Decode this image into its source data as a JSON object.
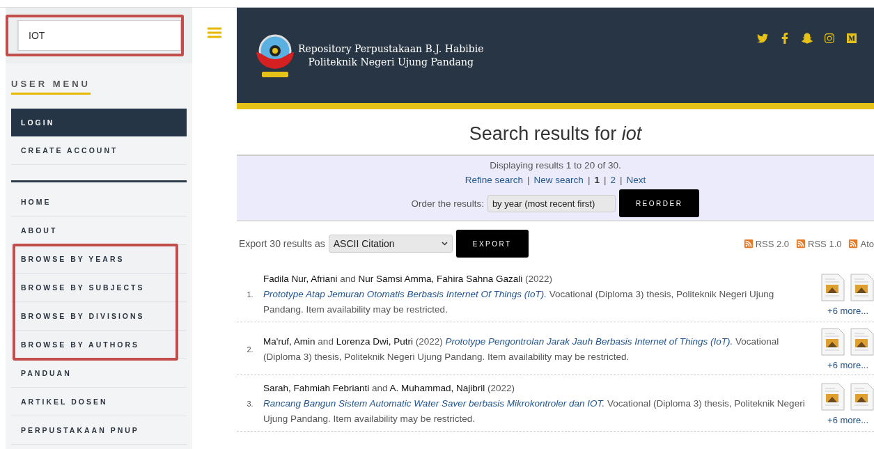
{
  "sidebar": {
    "search": {
      "value": "IOT",
      "highlighted": true
    },
    "user_menu": {
      "title": "USER MENU",
      "items": [
        {
          "label": "LOGIN",
          "selected": true
        },
        {
          "label": "CREATE ACCOUNT",
          "selected": false
        }
      ]
    },
    "nav_items": [
      {
        "label": "HOME",
        "highlighted": false
      },
      {
        "label": "ABOUT",
        "highlighted": false
      },
      {
        "label": "BROWSE BY YEARS",
        "highlighted": true
      },
      {
        "label": "BROWSE BY SUBJECTS",
        "highlighted": true
      },
      {
        "label": "BROWSE BY DIVISIONS",
        "highlighted": true
      },
      {
        "label": "BROWSE BY AUTHORS",
        "highlighted": true
      },
      {
        "label": "PANDUAN",
        "highlighted": false
      },
      {
        "label": "ARTIKEL DOSEN",
        "highlighted": false
      },
      {
        "label": "PERPUSTAKAAN PNUP",
        "highlighted": false
      }
    ]
  },
  "header": {
    "title_lines": [
      "Repository Perpustakaan B.J. Habibie",
      "Politeknik Negeri Ujung Pandang"
    ]
  },
  "search_title": "Search results for *iot*",
  "summary": {
    "text": "Displaying results 1 to 20 of 30.",
    "separator": "|",
    "links": [
      {
        "label": "Refine search",
        "kind": "link"
      },
      {
        "label": "New search",
        "kind": "link"
      },
      {
        "label": "1",
        "kind": "current"
      },
      {
        "label": "2",
        "kind": "link"
      },
      {
        "label": "Next",
        "kind": "link"
      }
    ],
    "order_label": "Order the results:",
    "order_value": "by year (most recent first)",
    "reorder_button": "REORDER"
  },
  "export": {
    "label": "Export 30 results as",
    "format": "ASCII Citation",
    "button": "EXPORT",
    "feeds": [
      "RSS 2.0",
      "RSS 1.0",
      "Ato"
    ]
  },
  "results": [
    {
      "number": "1.",
      "authors": "**Fadila Nur, Afriani** and **Nur Samsi Amma, Fahira Sahna Gazali**",
      "year": "(2022)",
      "title": "Prototype Atap Jemuran Otomatis Berbasis Internet Of Things (IoT).",
      "rest": "Vocational (Diploma 3) thesis, Politeknik Negeri Ujung Pandang. Item availability may be restricted.",
      "more": "+6 more..."
    },
    {
      "number": "2.",
      "authors": "**Ma'ruf, Amin** and **Lorenza Dwi, Putri**",
      "year": "(2022)",
      "title": "Prototype Pengontrolan Jarak Jauh Berbasis Internet of Things (IoT).",
      "rest": "Vocational (Diploma 3) thesis, Politeknik Negeri Ujung Pandang. Item availability may be restricted.",
      "more": "+6 more..."
    },
    {
      "number": "3.",
      "authors": "**Sarah, Fahmiah Febrianti** and **A. Muhammad, Najibril**",
      "year": "(2022)",
      "title": "Rancang Bangun Sistem Automatic Water Saver berbasis Mikrokontroler dan IOT.",
      "rest": "Vocational (Diploma 3) thesis, Politeknik Negeri Ujung Pandang. Item availability may be restricted.",
      "more": "+6 more..."
    }
  ]
}
